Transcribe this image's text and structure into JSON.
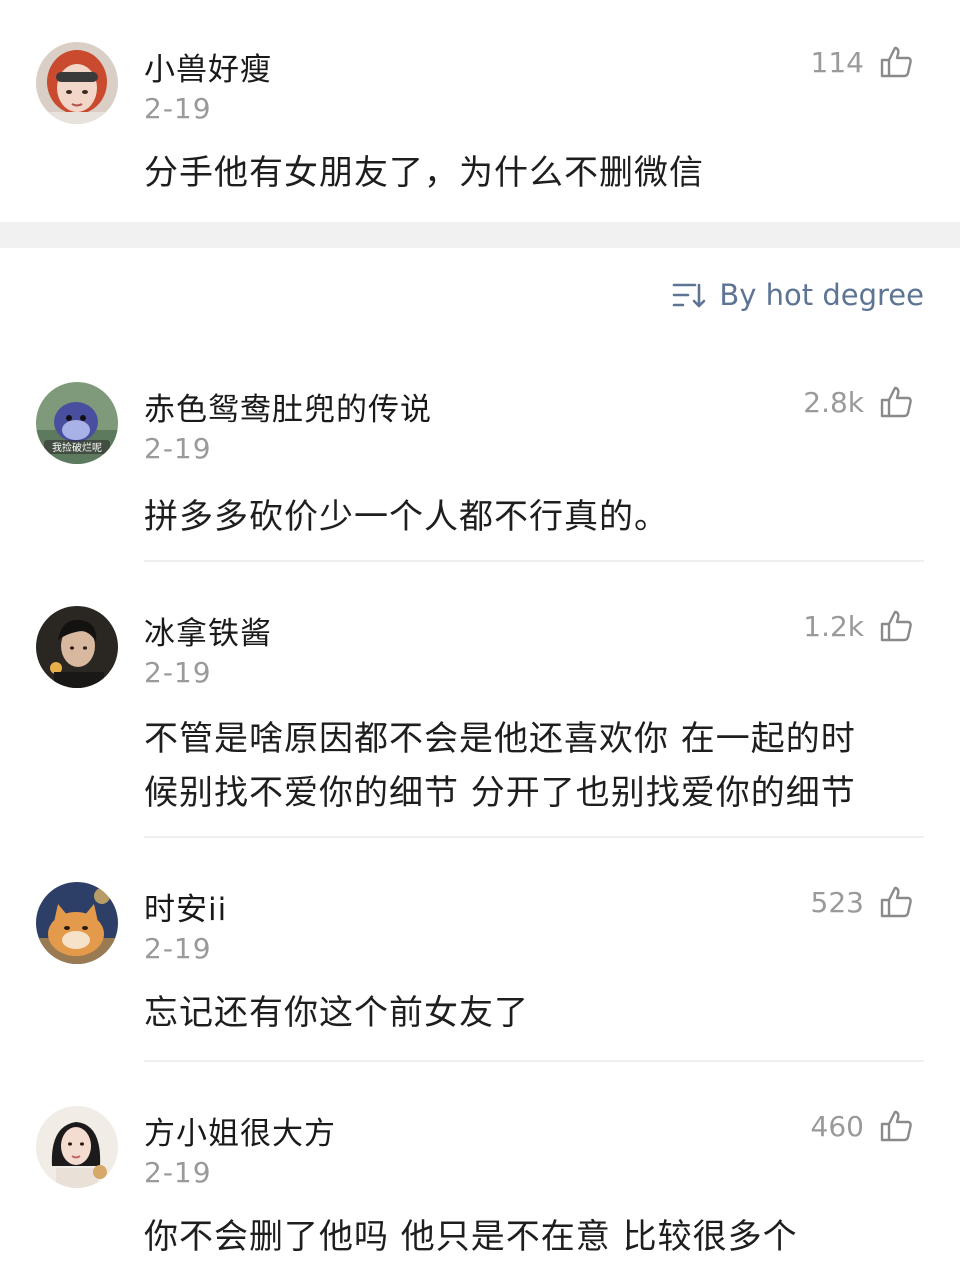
{
  "sort": {
    "label": "By hot degree",
    "icon": "sort-lines-icon"
  },
  "colors": {
    "accent": "#5d7495",
    "meta": "#9a9a9a",
    "band": "#f1f1f1",
    "divider": "#efefef"
  },
  "top_comment": {
    "username": "小兽好瘦",
    "date": "2-19",
    "likes": "114",
    "text": "分手他有女朋友了，为什么不删微信"
  },
  "comments": [
    {
      "username": "赤色鸳鸯肚兜的传说",
      "date": "2-19",
      "likes": "2.8k",
      "text": "拼多多砍价少一个人都不行真的。",
      "avatar_caption": "我捡破烂呢"
    },
    {
      "username": "冰拿铁酱",
      "date": "2-19",
      "likes": "1.2k",
      "text_line1": "不管是啥原因都不会是他还喜欢你  在一起的时",
      "text_line2": "候别找不爱你的细节  分开了也别找爱你的细节"
    },
    {
      "username": "时安ii",
      "date": "2-19",
      "likes": "523",
      "text": "忘记还有你这个前女友了"
    },
    {
      "username": "方小姐很大方",
      "date": "2-19",
      "likes": "460",
      "text": "你不会删了他吗 他只是不在意 比较很多个"
    }
  ]
}
